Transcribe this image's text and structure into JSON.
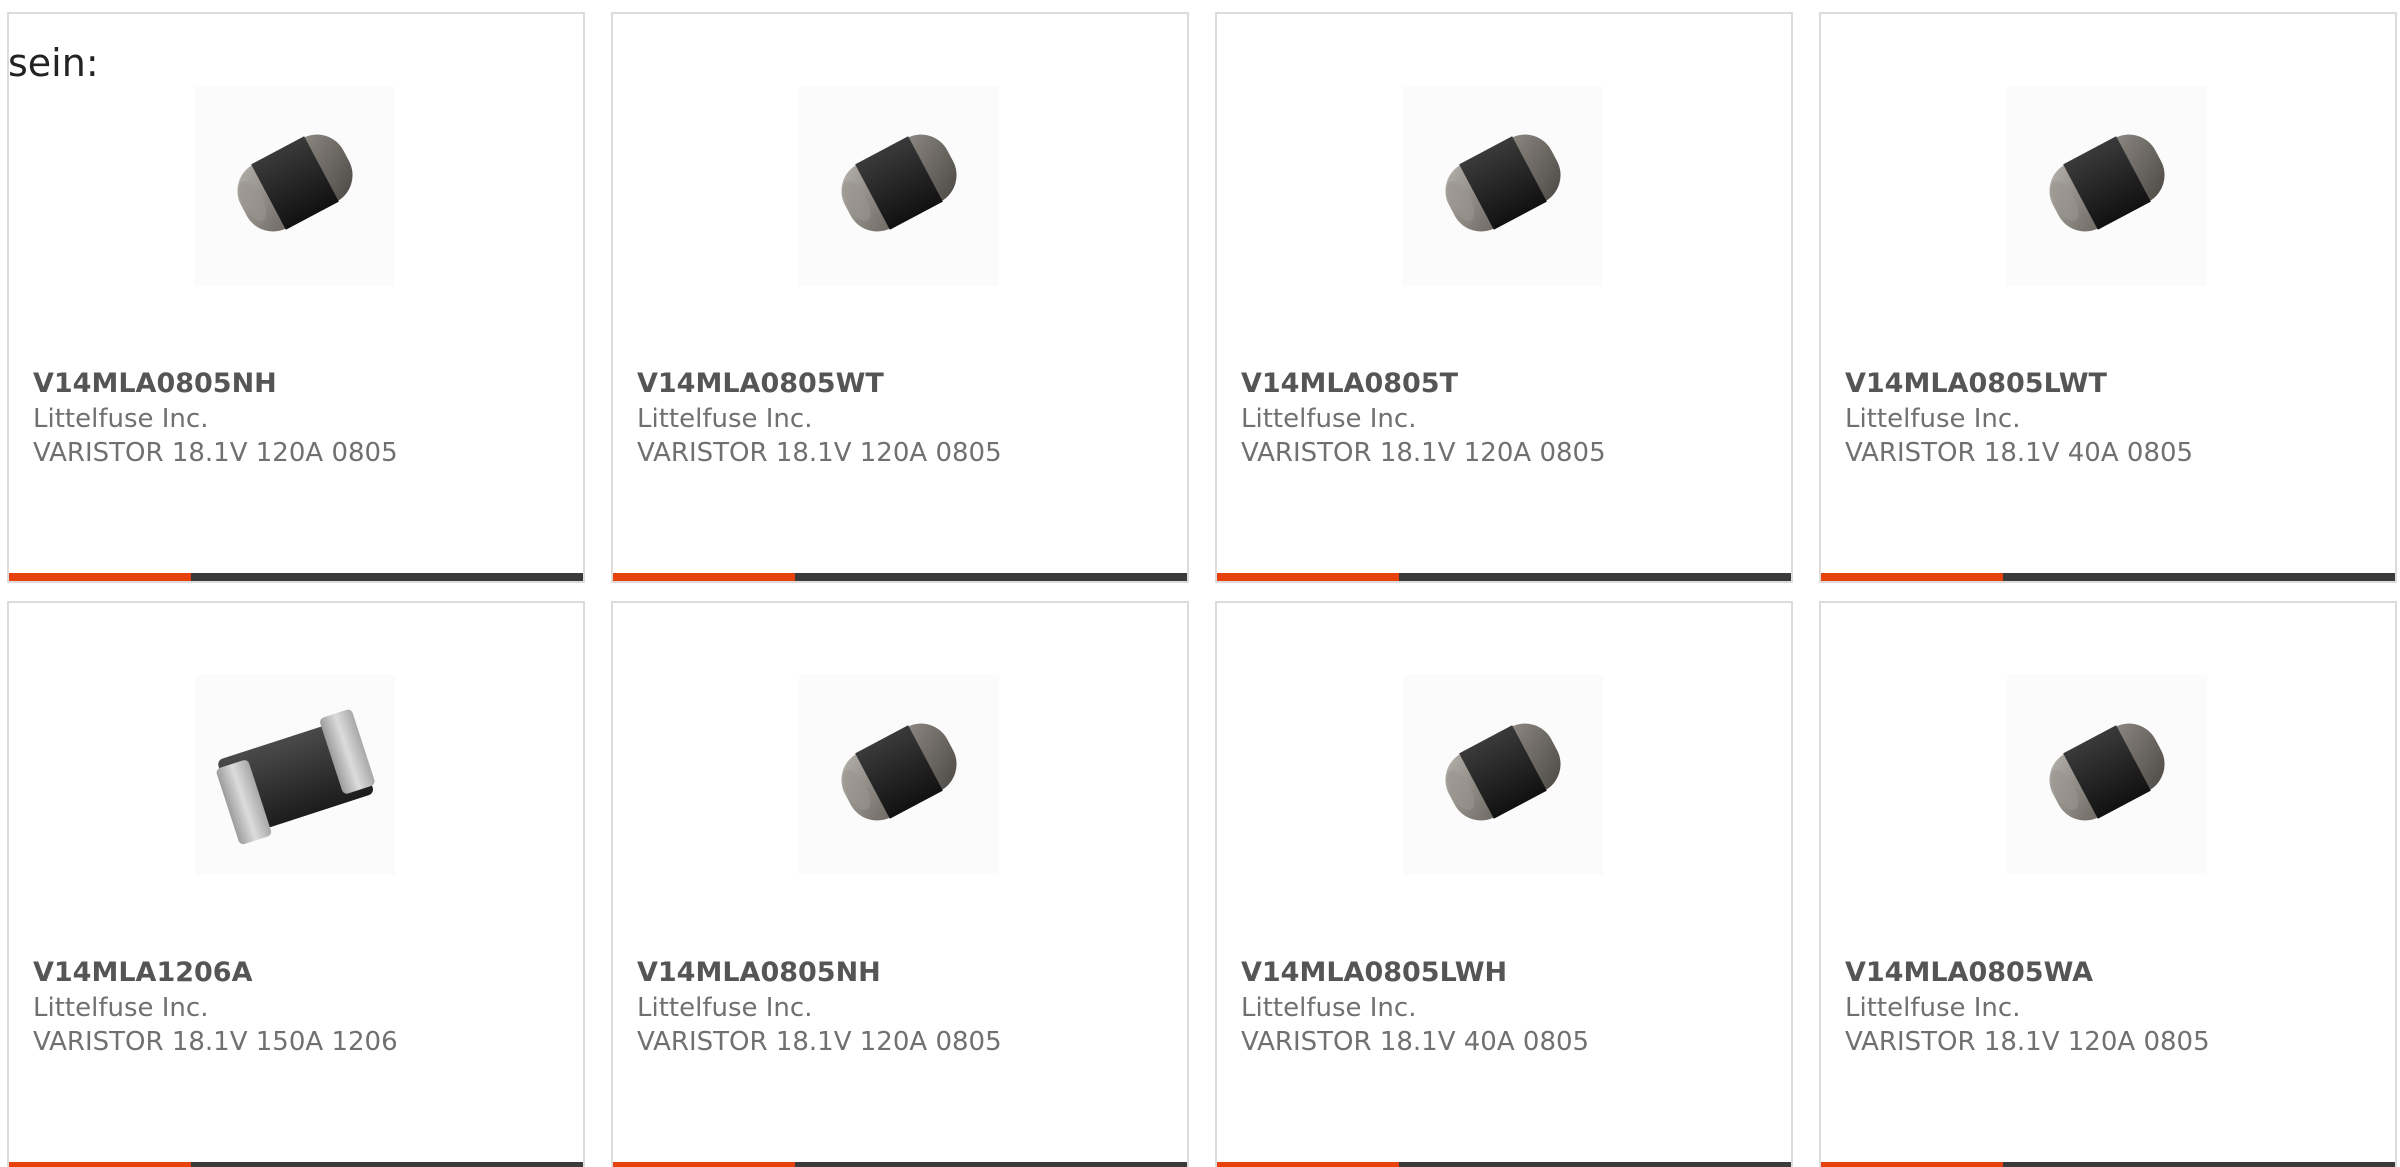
{
  "lead_text": "sein:",
  "colors": {
    "accent": "#e8420c",
    "bar": "#3a3a3a",
    "border": "#dcdcdc",
    "text_muted": "#707070",
    "text_strong": "#555555"
  },
  "products": [
    {
      "part_number": "V14MLA0805NH",
      "manufacturer": "Littelfuse Inc.",
      "description": "VARISTOR 18.1V 120A 0805",
      "image": "chip-varistor-0805-icon"
    },
    {
      "part_number": "V14MLA0805WT",
      "manufacturer": "Littelfuse Inc.",
      "description": "VARISTOR 18.1V 120A 0805",
      "image": "chip-varistor-0805-icon"
    },
    {
      "part_number": "V14MLA0805T",
      "manufacturer": "Littelfuse Inc.",
      "description": "VARISTOR 18.1V 120A 0805",
      "image": "chip-varistor-0805-icon"
    },
    {
      "part_number": "V14MLA0805LWT",
      "manufacturer": "Littelfuse Inc.",
      "description": "VARISTOR 18.1V 40A 0805",
      "image": "chip-varistor-0805-icon"
    },
    {
      "part_number": "V14MLA1206A",
      "manufacturer": "Littelfuse Inc.",
      "description": "VARISTOR 18.1V 150A 1206",
      "image": "chip-varistor-1206-icon"
    },
    {
      "part_number": "V14MLA0805NH",
      "manufacturer": "Littelfuse Inc.",
      "description": "VARISTOR 18.1V 120A 0805",
      "image": "chip-varistor-0805-icon"
    },
    {
      "part_number": "V14MLA0805LWH",
      "manufacturer": "Littelfuse Inc.",
      "description": "VARISTOR 18.1V 40A 0805",
      "image": "chip-varistor-0805-icon"
    },
    {
      "part_number": "V14MLA0805WA",
      "manufacturer": "Littelfuse Inc.",
      "description": "VARISTOR 18.1V 120A 0805",
      "image": "chip-varistor-0805-icon"
    }
  ]
}
